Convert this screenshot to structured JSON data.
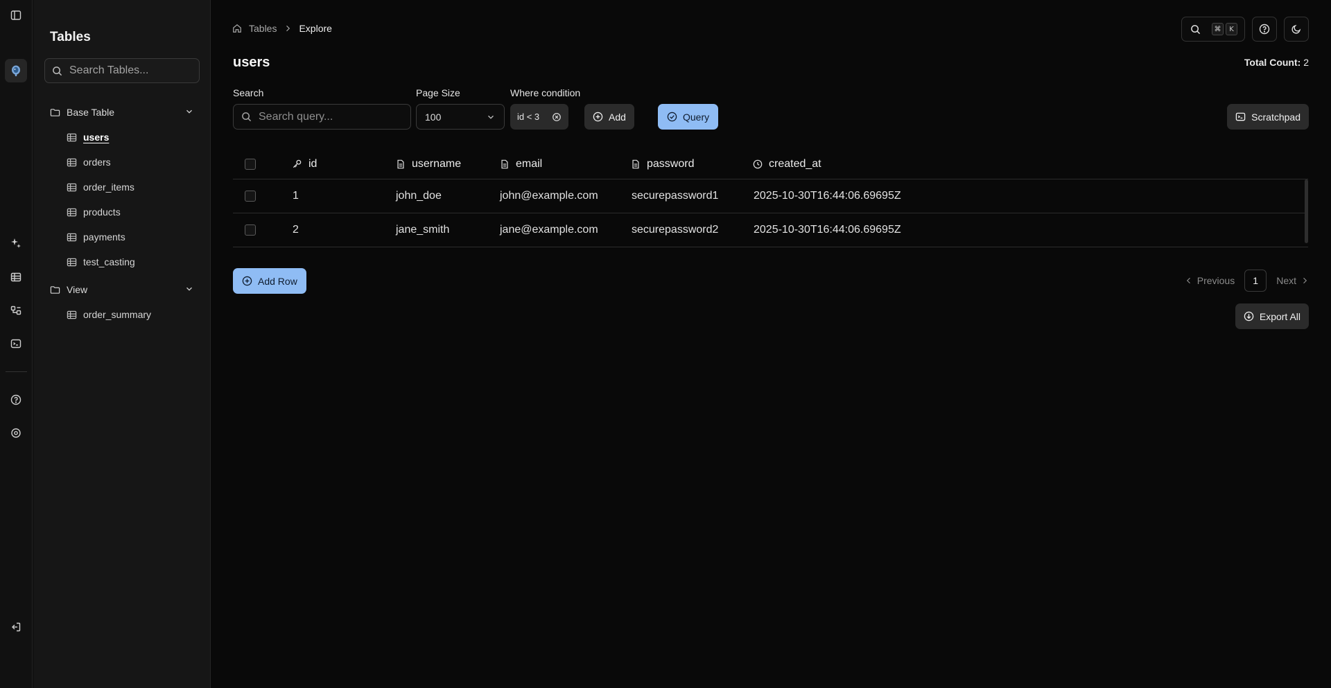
{
  "sidebar": {
    "title": "Tables",
    "search_placeholder": "Search Tables...",
    "groups": [
      {
        "label": "Base Table",
        "items": [
          "users",
          "orders",
          "order_items",
          "products",
          "payments",
          "test_casting"
        ]
      },
      {
        "label": "View",
        "items": [
          "order_summary"
        ]
      }
    ],
    "active_item": "users"
  },
  "breadcrumb": {
    "home": "Tables",
    "current": "Explore"
  },
  "shortcut": {
    "modifier": "⌘",
    "key": "K"
  },
  "page": {
    "title": "users",
    "total_label": "Total Count:",
    "total_value": "2"
  },
  "filters": {
    "search_label": "Search",
    "search_placeholder": "Search query...",
    "page_size_label": "Page Size",
    "page_size_value": "100",
    "where_label": "Where condition",
    "where_chip": "id < 3",
    "add_label": "Add",
    "query_label": "Query",
    "scratchpad_label": "Scratchpad"
  },
  "table": {
    "columns": [
      {
        "name": "id",
        "icon": "key-icon"
      },
      {
        "name": "username",
        "icon": "file-text-icon"
      },
      {
        "name": "email",
        "icon": "file-text-icon"
      },
      {
        "name": "password",
        "icon": "file-text-icon"
      },
      {
        "name": "created_at",
        "icon": "clock-icon"
      }
    ],
    "rows": [
      [
        "1",
        "john_doe",
        "john@example.com",
        "securepassword1",
        "2025-10-30T16:44:06.69695Z"
      ],
      [
        "2",
        "jane_smith",
        "jane@example.com",
        "securepassword2",
        "2025-10-30T16:44:06.69695Z"
      ]
    ]
  },
  "actions": {
    "add_row": "Add Row",
    "export_all": "Export All"
  },
  "pagination": {
    "previous": "Previous",
    "page": "1",
    "next": "Next"
  },
  "colors": {
    "accent": "#8fbcf4",
    "background": "#090909",
    "sidebar": "#161616"
  }
}
